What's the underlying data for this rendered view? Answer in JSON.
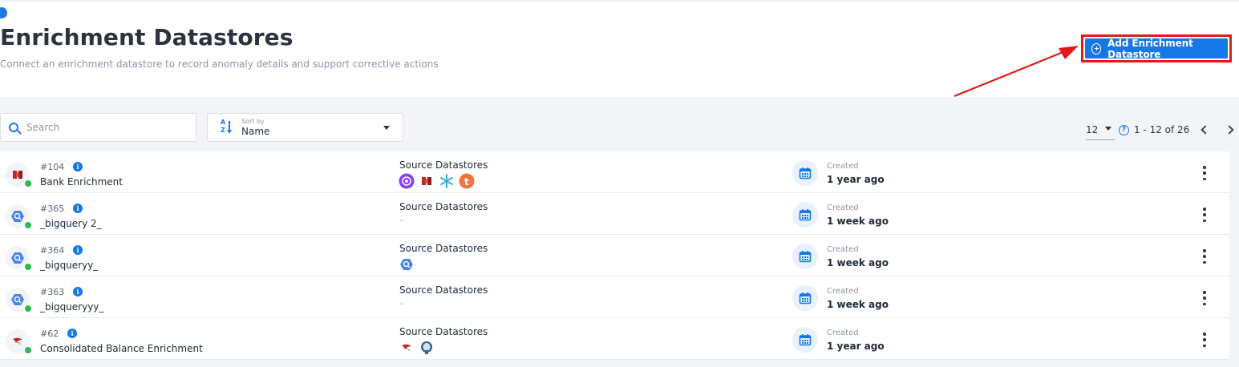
{
  "page": {
    "title": "Enrichment Datastores",
    "subtitle": "Connect an enrichment datastore to record anomaly details and support corrective actions",
    "add_button_label": "Add Enrichment Datastore"
  },
  "toolbar": {
    "search_placeholder": "Search",
    "sort_caption": "Sort by",
    "sort_value": "Name",
    "page_size": "12",
    "range_text": "1 - 12 of 26",
    "help_glyph": "?"
  },
  "columns": {
    "source_label": "Source Datastores",
    "created_label": "Created"
  },
  "rows": [
    {
      "id": "#104",
      "name": "Bank Enrichment",
      "icon": "redshift-icon",
      "status_color": "#2dbb4e",
      "sources": [
        "athena-icon",
        "redshift-icon",
        "snowflake-icon",
        "teradata-icon"
      ],
      "sources_empty": "",
      "created": "1 year ago"
    },
    {
      "id": "#365",
      "name": "_bigquery 2_",
      "icon": "bigquery-icon",
      "status_color": "#2dbb4e",
      "sources": [],
      "sources_empty": "–",
      "created": "1 week ago"
    },
    {
      "id": "#364",
      "name": "_bigqueryy_",
      "icon": "bigquery-icon",
      "status_color": "#2dbb4e",
      "sources": [
        "bigquery-icon"
      ],
      "sources_empty": "",
      "created": "1 week ago"
    },
    {
      "id": "#363",
      "name": "_bigqueryyy_",
      "icon": "bigquery-icon",
      "status_color": "#2dbb4e",
      "sources": [],
      "sources_empty": "–",
      "created": "1 week ago"
    },
    {
      "id": "#62",
      "name": "Consolidated Balance Enrichment",
      "icon": "mssql-icon",
      "status_color": "#2dbb4e",
      "sources": [
        "mssql-icon",
        "postgresql-icon"
      ],
      "sources_empty": "",
      "created": "1 year ago"
    }
  ],
  "colors": {
    "accent": "#1677e6",
    "highlight_border": "#e11b1b",
    "status_green": "#2dbb4e"
  }
}
